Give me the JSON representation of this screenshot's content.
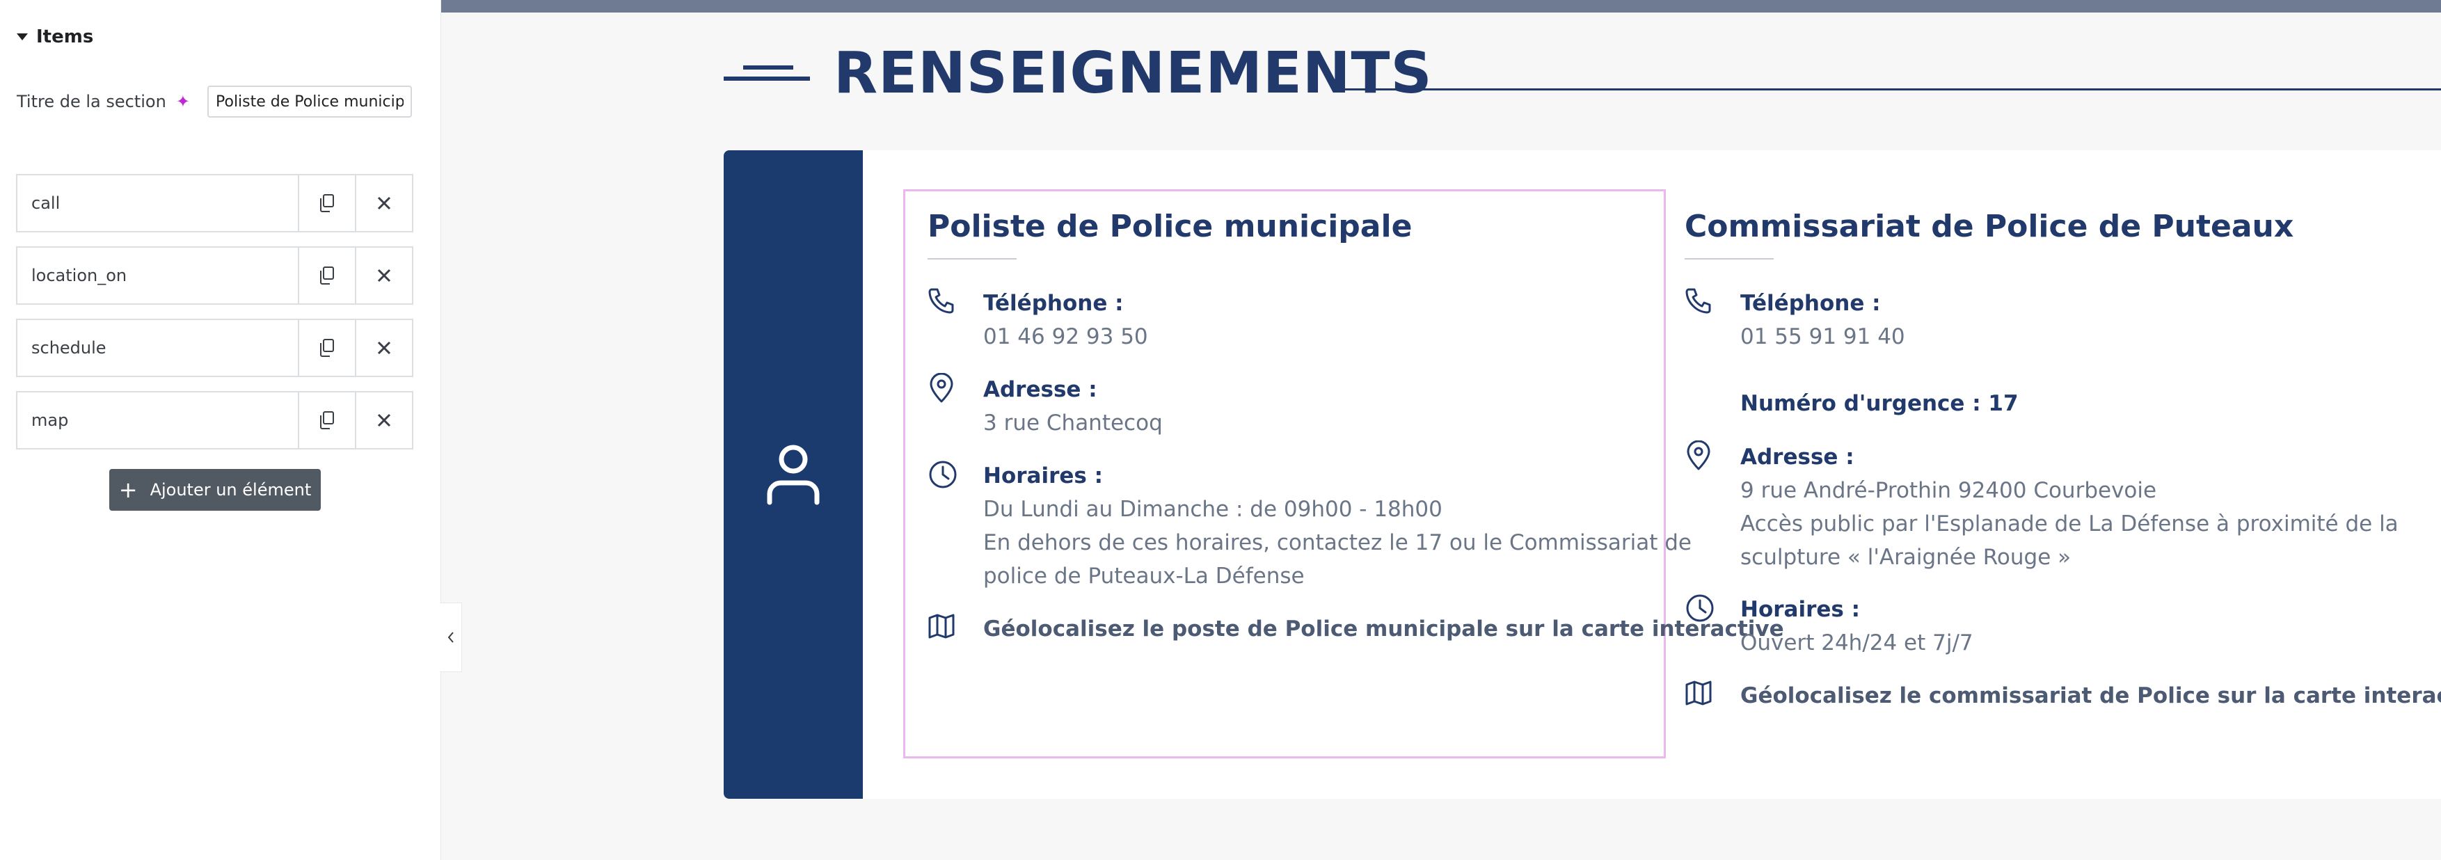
{
  "panel": {
    "section_title": "Items",
    "field_label": "Titre de la section",
    "field_value": "Poliste de Police municipale",
    "items": [
      {
        "label": "call"
      },
      {
        "label": "location_on"
      },
      {
        "label": "schedule"
      },
      {
        "label": "map"
      }
    ],
    "add_button": "Ajouter un élément"
  },
  "preview": {
    "heading": "RENSEIGNEMENTS",
    "colors": {
      "navy": "#1b3a6e",
      "heading": "#213a6b",
      "selection": "#eab8ec",
      "body_text": "#6a7587"
    },
    "left": {
      "title": "Poliste de Police municipale",
      "phone_label": "Téléphone :",
      "phone_value": "01 46 92 93 50",
      "address_label": "Adresse :",
      "address_value": "3 rue Chantecoq",
      "hours_label": "Horaires :",
      "hours_line1": "Du Lundi au Dimanche : de 09h00 - 18h00",
      "hours_line2": "En dehors de ces horaires, contactez le 17 ou le Commissariat de",
      "hours_line3": "police de Puteaux-La Défense",
      "map_link": "Géolocalisez le poste de Police municipale sur la carte interactive"
    },
    "right": {
      "title": "Commissariat de Police de Puteaux",
      "phone_label": "Téléphone :",
      "phone_value": "01 55 91 91 40",
      "emergency": "Numéro d'urgence : 17",
      "address_label": "Adresse :",
      "address_line1": "9 rue André-Prothin 92400 Courbevoie",
      "address_line2": "Accès public par l'Esplanade de La Défense à proximité de la",
      "address_line3": "sculpture « l'Araignée Rouge »",
      "hours_label": "Horaires :",
      "hours_value": "Ouvert 24h/24 et 7j/7",
      "map_link": "Géolocalisez le commissariat de Police sur la carte interactive"
    }
  }
}
